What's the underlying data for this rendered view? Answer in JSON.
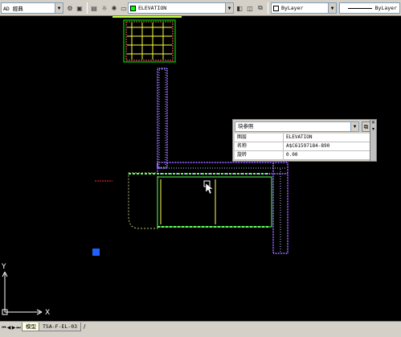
{
  "toolbar": {
    "workspace_label": "AD 經典",
    "layer_name": "ELEVATION",
    "color_value": "ByLayer",
    "linetype_value": "ByLayer",
    "layer_color": "#00ff00",
    "color_swatch": "#ffffff"
  },
  "canvas": {
    "background": "#000000",
    "ucs_x_label": "X",
    "ucs_y_label": "Y"
  },
  "quick_properties": {
    "object_type": "块参照",
    "rows": [
      {
        "label": "图层",
        "value": "ELEVATION"
      },
      {
        "label": "名称",
        "value": "A$C61597184-890"
      },
      {
        "label": "旋转",
        "value": "0.00"
      }
    ]
  },
  "tabs": {
    "items": [
      "模型",
      "TSA-F-EL-03"
    ],
    "separator": "/"
  },
  "icons": [
    "dropdown-arrow-icon",
    "layer-properties-icon",
    "lightbulb-icon",
    "sun-icon",
    "lock-icon",
    "make-current-icon",
    "layer-previous-icon",
    "quick-select-icon",
    "close-icon",
    "tab-nav-icon",
    "ucs-icon"
  ]
}
